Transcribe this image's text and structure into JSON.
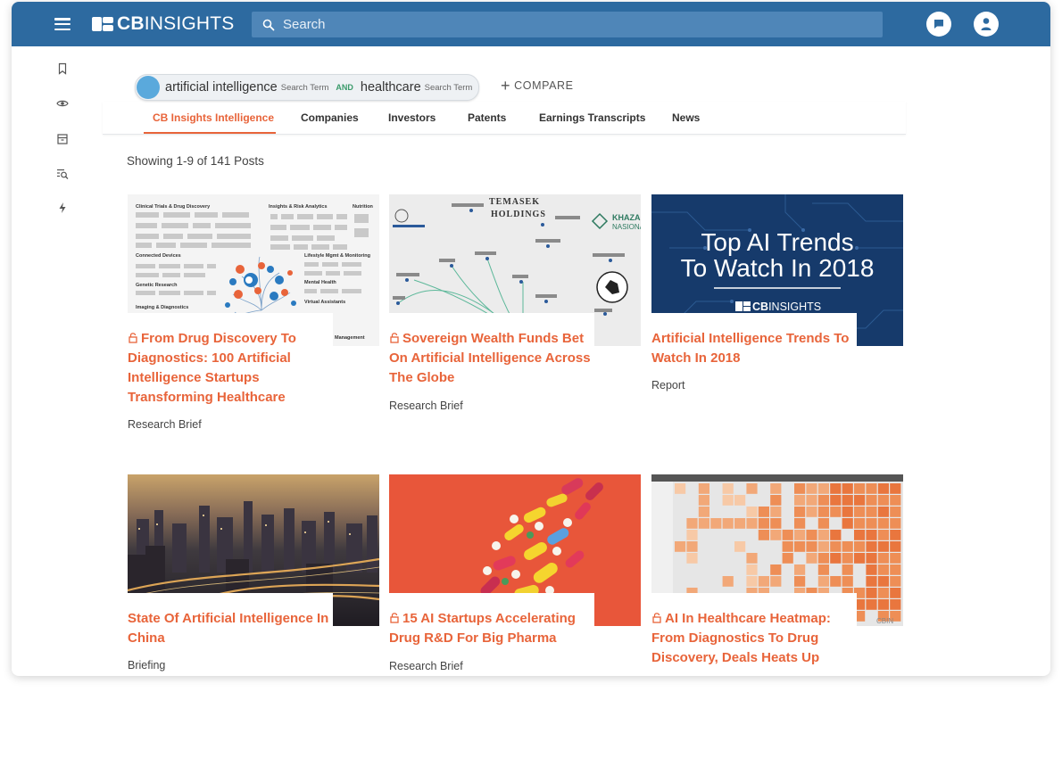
{
  "header": {
    "logo_bold": "CB",
    "logo_light": "INSIGHTS",
    "search_placeholder": "Search",
    "icons": [
      "menu-icon",
      "chat-icon",
      "user-icon"
    ]
  },
  "sidebar": {
    "icons": [
      "bookmark-icon",
      "eye-icon",
      "archive-icon",
      "search-list-icon",
      "lightning-icon"
    ]
  },
  "query": {
    "term1": "artificial intelligence",
    "term1_tag": "Search Term",
    "operator": "AND",
    "term2": "healthcare",
    "term2_tag": "Search Term",
    "compare_label": "COMPARE"
  },
  "tabs": [
    {
      "label": "CB Insights Intelligence",
      "active": true
    },
    {
      "label": "Companies"
    },
    {
      "label": "Investors"
    },
    {
      "label": "Patents"
    },
    {
      "label": "Earnings Transcripts"
    },
    {
      "label": "News"
    }
  ],
  "results_count": "Showing 1-9 of 141 Posts",
  "cards": [
    {
      "title": "From Drug Discovery To Diagnostics: 100 Artificial Intelligence Startups Transforming Healthcare",
      "type": "Research Brief",
      "locked": true
    },
    {
      "title": "Sovereign Wealth Funds Bet On Artificial Intelligence Across The Globe",
      "type": "Research Brief",
      "locked": true
    },
    {
      "title": "Artificial Intelligence Trends To Watch In 2018",
      "type": "Report",
      "locked": false
    },
    {
      "title": "State Of Artificial Intelligence In China",
      "type": "Briefing",
      "locked": false
    },
    {
      "title": "15 AI Startups Accelerating Drug R&D For Big Pharma",
      "type": "Research Brief",
      "locked": true
    },
    {
      "title": "AI In Healthcare Heatmap: From Diagnostics To Drug Discovery, Deals Heats Up",
      "type": "",
      "locked": true
    }
  ],
  "thumbs": {
    "card1": {
      "headers": [
        "Clinical Trials & Drug Discovery",
        "Insights & Risk Analytics",
        "Nutrition",
        "Connected Devices",
        "Lifestyle Mgmt & Monitoring",
        "Genetic Research",
        "Mental Health",
        "Imaging & Diagnostics",
        "Virtual Assistants",
        "Management"
      ]
    },
    "card2": {
      "labels": [
        "TEMASEK",
        "HOLDINGS",
        "KHAZAN",
        "NASIONA"
      ]
    },
    "card3": {
      "line1": "Top AI Trends",
      "line2": "To Watch In 2018",
      "brand_bold": "CB",
      "brand_light": "INSIGHTS"
    },
    "card6": {
      "brand": "CBIN"
    }
  },
  "colors": {
    "header_bg": "#2d6aa0",
    "accent": "#e8643a",
    "search_bg": "#4f86b8"
  }
}
